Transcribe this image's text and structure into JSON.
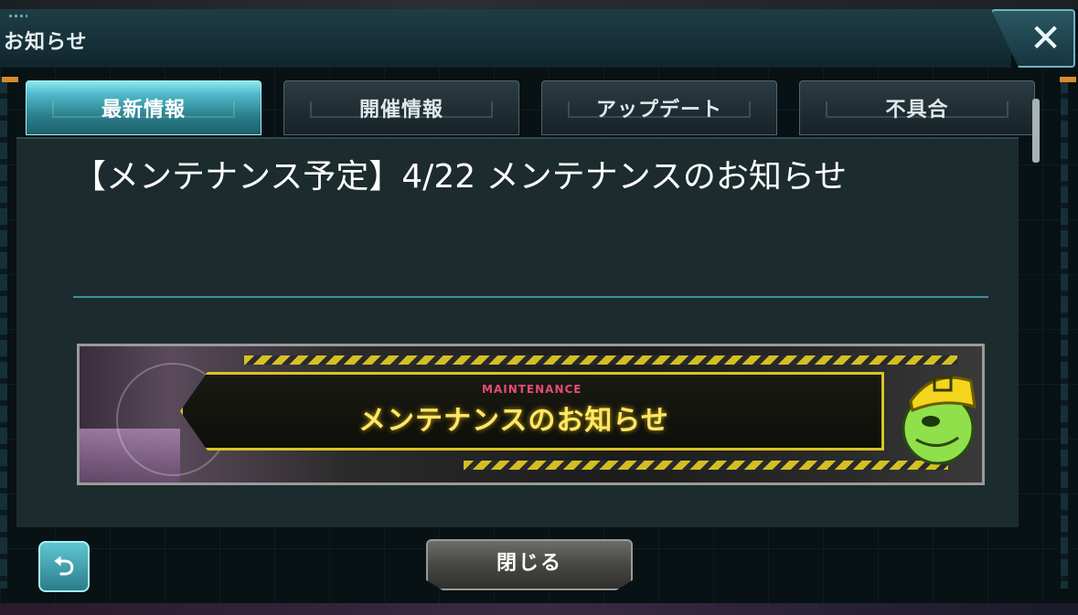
{
  "header": {
    "title": "お知らせ",
    "close_label": "✕"
  },
  "tabs": [
    {
      "label": "最新情報",
      "active": true
    },
    {
      "label": "開催情報",
      "active": false
    },
    {
      "label": "アップデート",
      "active": false
    },
    {
      "label": "不具合",
      "active": false
    }
  ],
  "notice": {
    "title": "【メンテナンス予定】4/22 メンテナンスのお知らせ",
    "banner_sub": "MAINTENANCE",
    "banner_main": "メンテナンスのお知らせ"
  },
  "footer": {
    "back_icon": "return-arrow-icon",
    "back_glyph": "⮌",
    "close_label": "閉じる"
  },
  "colors": {
    "accent": "#4fb8c8",
    "banner_yellow": "#ffe76a",
    "banner_pink": "#e84a7a"
  }
}
